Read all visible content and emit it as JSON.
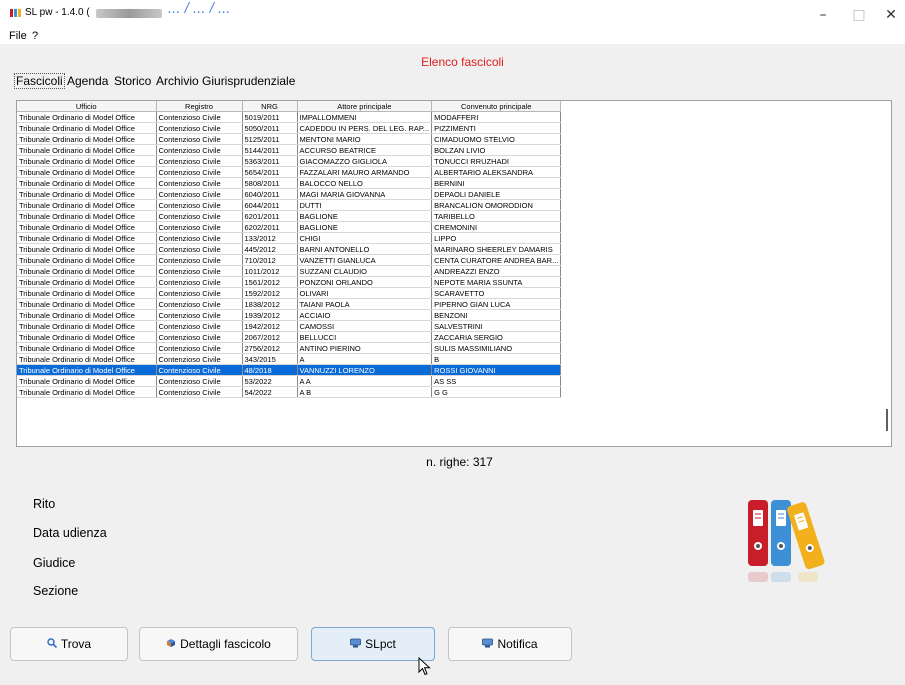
{
  "window": {
    "title": "SL pw - 1.4.0 (",
    "overlay_text": "... / ... / ...",
    "minimize_glyph": "–",
    "maximize_glyph": "□",
    "close_glyph": "✕"
  },
  "menu": {
    "file": "File",
    "help": "?"
  },
  "heading": "Elenco fascicoli",
  "tabs": [
    "Fascicoli",
    "Agenda",
    "Storico",
    "Archivio Giurisprudenziale"
  ],
  "table": {
    "columns": [
      "Ufficio",
      "Registro",
      "NRG",
      "Attore principale",
      "Convenuto principale"
    ],
    "rows": [
      [
        "Tribunale Ordinario di Model Office",
        "Contenzioso Civile",
        "5019/2011",
        "IMPALLOMMENI",
        "MODAFFERI"
      ],
      [
        "Tribunale Ordinario di Model Office",
        "Contenzioso Civile",
        "5050/2011",
        "CADEDDU IN PERS. DEL LEG. RAP...",
        "PIZZIMENTI"
      ],
      [
        "Tribunale Ordinario di Model Office",
        "Contenzioso Civile",
        "5125/2011",
        "MENTONI MARIO",
        "CIMADUOMO STELVIO"
      ],
      [
        "Tribunale Ordinario di Model Office",
        "Contenzioso Civile",
        "5144/2011",
        "ACCURSO BEATRICE",
        "BOLZAN LIVIO"
      ],
      [
        "Tribunale Ordinario di Model Office",
        "Contenzioso Civile",
        "5363/2011",
        "GIACOMAZZO GIGLIOLA",
        "TONUCCI RRUZHADI"
      ],
      [
        "Tribunale Ordinario di Model Office",
        "Contenzioso Civile",
        "5654/2011",
        "FAZZALARI MAURO ARMANDO",
        "ALBERTARIO ALEKSANDRA"
      ],
      [
        "Tribunale Ordinario di Model Office",
        "Contenzioso Civile",
        "5808/2011",
        "BALOCCO NELLO",
        "BERNINI"
      ],
      [
        "Tribunale Ordinario di Model Office",
        "Contenzioso Civile",
        "6040/2011",
        "MAGI MARIA GIOVANNA",
        "DEPAOLI DANIELE"
      ],
      [
        "Tribunale Ordinario di Model Office",
        "Contenzioso Civile",
        "6044/2011",
        "DUTTI",
        "BRANCALION OMORODION"
      ],
      [
        "Tribunale Ordinario di Model Office",
        "Contenzioso Civile",
        "6201/2011",
        "BAGLIONE",
        "TARIBELLO"
      ],
      [
        "Tribunale Ordinario di Model Office",
        "Contenzioso Civile",
        "6202/2011",
        "BAGLIONE",
        "CREMONINI"
      ],
      [
        "Tribunale Ordinario di Model Office",
        "Contenzioso Civile",
        "133/2012",
        "CHIGI",
        "LIPPO"
      ],
      [
        "Tribunale Ordinario di Model Office",
        "Contenzioso Civile",
        "445/2012",
        "BARNI ANTONELLO",
        "MARINARO SHEERLEY DAMARIS"
      ],
      [
        "Tribunale Ordinario di Model Office",
        "Contenzioso Civile",
        "710/2012",
        "VANZETTI GIANLUCA",
        "CENTA CURATORE ANDREA BAR..."
      ],
      [
        "Tribunale Ordinario di Model Office",
        "Contenzioso Civile",
        "1011/2012",
        "SUZZANI CLAUDIO",
        "ANDREAZZI ENZO"
      ],
      [
        "Tribunale Ordinario di Model Office",
        "Contenzioso Civile",
        "1561/2012",
        "PONZONI ORLANDO",
        "NEPOTE MARIA SSUNTA"
      ],
      [
        "Tribunale Ordinario di Model Office",
        "Contenzioso Civile",
        "1592/2012",
        "OLIVARI",
        "SCARAVETTO"
      ],
      [
        "Tribunale Ordinario di Model Office",
        "Contenzioso Civile",
        "1838/2012",
        "TAIANI PAOLA",
        "PIPERNO GIAN LUCA"
      ],
      [
        "Tribunale Ordinario di Model Office",
        "Contenzioso Civile",
        "1939/2012",
        "ACCIAIO",
        "BENZONI"
      ],
      [
        "Tribunale Ordinario di Model Office",
        "Contenzioso Civile",
        "1942/2012",
        "CAMOSSI",
        "SALVESTRINI"
      ],
      [
        "Tribunale Ordinario di Model Office",
        "Contenzioso Civile",
        "2067/2012",
        "BELLUCCI",
        "ZACCARIA SERGIO"
      ],
      [
        "Tribunale Ordinario di Model Office",
        "Contenzioso Civile",
        "2756/2012",
        "ANTINO PIERINO",
        "SULIS MASSIMILIANO"
      ],
      [
        "Tribunale Ordinario di Model Office",
        "Contenzioso Civile",
        "343/2015",
        "A",
        "B"
      ],
      [
        "Tribunale Ordinario di Model Office",
        "Contenzioso Civile",
        "48/2018",
        "VANNUZZI LORENZO",
        "ROSSI GIOVANNI"
      ],
      [
        "Tribunale Ordinario di Model Office",
        "Contenzioso Civile",
        "53/2022",
        "A A",
        "AS SS"
      ],
      [
        "Tribunale Ordinario di Model Office",
        "Contenzioso Civile",
        "54/2022",
        "A B",
        "G G"
      ]
    ],
    "selected_nrg": "48/2018"
  },
  "row_count": "n. righe: 317",
  "details": {
    "rito": "Rito",
    "data_udienza": "Data udienza",
    "giudice": "Giudice",
    "sezione": "Sezione"
  },
  "buttons": {
    "trova": "Trova",
    "dettagli": "Dettagli fascicolo",
    "slpct": "SLpct",
    "notifica": "Notifica"
  },
  "colors": {
    "heading_red": "#e02020",
    "selection_blue": "#0a6ad8",
    "binder_red": "#c81e2a",
    "binder_blue": "#3d8fd6",
    "binder_yellow": "#f2b11c"
  }
}
